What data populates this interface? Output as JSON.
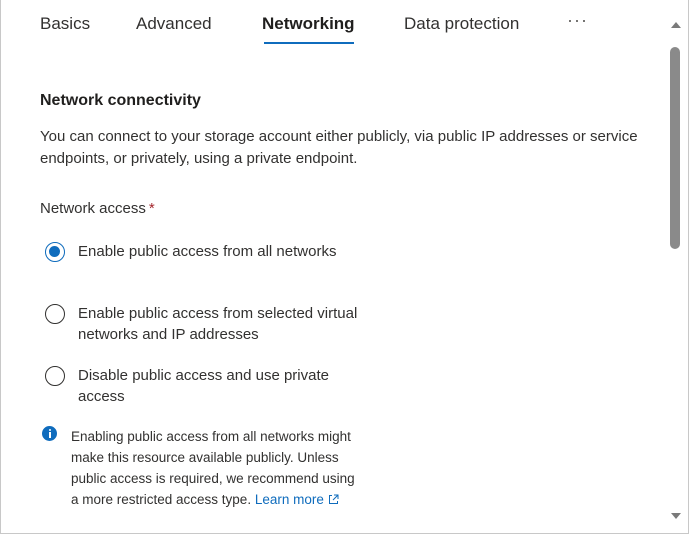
{
  "tabs": [
    {
      "label": "Basics",
      "active": false
    },
    {
      "label": "Advanced",
      "active": false
    },
    {
      "label": "Networking",
      "active": true
    },
    {
      "label": "Data protection",
      "active": false
    }
  ],
  "tabs_more": "···",
  "section": {
    "title": "Network connectivity",
    "description": "You can connect to your storage account either publicly, via public IP addresses or service endpoints, or privately, using a private endpoint."
  },
  "network_access": {
    "label": "Network access",
    "required_marker": "*",
    "options": [
      {
        "label": "Enable public access from all networks",
        "selected": true
      },
      {
        "label": "Enable public access from selected virtual networks and IP addresses",
        "selected": false
      },
      {
        "label": "Disable public access and use private access",
        "selected": false
      }
    ]
  },
  "info": {
    "icon": "info-icon",
    "text": "Enabling public access from all networks might make this resource available publicly. Unless public access is required, we recommend using a more restricted access type.",
    "link_label": "Learn more",
    "link_icon": "external-link-icon"
  },
  "colors": {
    "accent": "#0f6cbd",
    "required": "#a4262c",
    "text": "#323130"
  }
}
